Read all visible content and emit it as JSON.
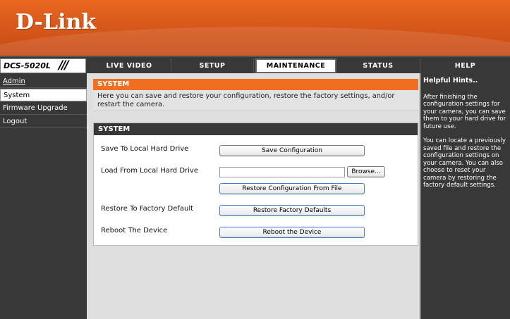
{
  "brand": {
    "logo_text": "D-Link"
  },
  "model": {
    "name": "DCS-5020L",
    "slashes": "///"
  },
  "nav": {
    "tabs": [
      {
        "label": "LIVE VIDEO"
      },
      {
        "label": "SETUP"
      },
      {
        "label": "MAINTENANCE"
      },
      {
        "label": "STATUS"
      },
      {
        "label": "HELP"
      }
    ],
    "active_tab": "MAINTENANCE"
  },
  "sidebar": {
    "items": [
      {
        "label": "Admin"
      },
      {
        "label": "System"
      },
      {
        "label": "Firmware Upgrade"
      },
      {
        "label": "Logout"
      }
    ]
  },
  "system": {
    "title": "SYSTEM",
    "description": "Here you can save and restore your configuration, restore the factory settings, and/or restart the camera.",
    "panel_title": "SYSTEM",
    "rows": {
      "save_label": "Save To Local Hard Drive",
      "save_button": "Save Configuration",
      "load_label": "Load From Local Hard Drive",
      "browse_button": "Browse...",
      "file_value": "",
      "restore_file_button": "Restore Configuration From File",
      "factory_label": "Restore To Factory Default",
      "factory_button": "Restore Factory Defaults",
      "reboot_label": "Reboot The Device",
      "reboot_button": "Reboot the Device"
    }
  },
  "hints": {
    "title": "Helpful Hints..",
    "p1": "After finishing the configuration settings for your camera, you can save them to your hard drive for future use.",
    "p2": "You can locate a previously saved file and restore the configuration settings on your camera. You can also choose to reset your camera by restoring the factory default settings."
  },
  "colors": {
    "accent": "#f26f21",
    "header": "#d4561a",
    "dark": "#383838"
  }
}
